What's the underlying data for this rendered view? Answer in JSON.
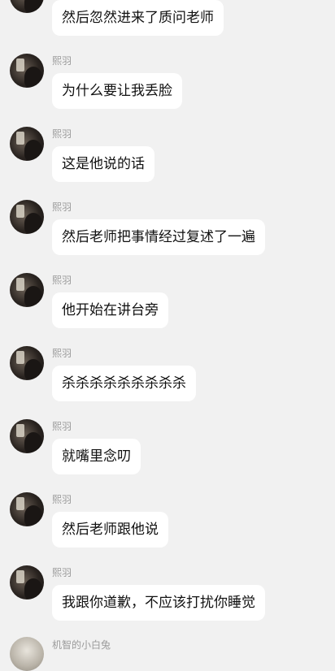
{
  "messages": [
    {
      "sender": "",
      "text": "然后忽然进来了质问老师"
    },
    {
      "sender": "熙羽",
      "text": "为什么要让我丢脸"
    },
    {
      "sender": "熙羽",
      "text": "这是他说的话"
    },
    {
      "sender": "熙羽",
      "text": "然后老师把事情经过复述了一遍"
    },
    {
      "sender": "熙羽",
      "text": "他开始在讲台旁"
    },
    {
      "sender": "熙羽",
      "text": "杀杀杀杀杀杀杀杀杀"
    },
    {
      "sender": "熙羽",
      "text": "就嘴里念叨"
    },
    {
      "sender": "熙羽",
      "text": "然后老师跟他说"
    },
    {
      "sender": "熙羽",
      "text": "我跟你道歉，不应该打扰你睡觉"
    },
    {
      "sender": "机智的小白兔",
      "text": ""
    }
  ]
}
